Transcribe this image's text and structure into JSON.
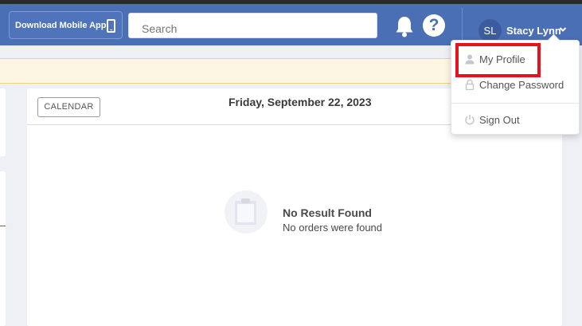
{
  "header": {
    "download_label": "Download Mobile App",
    "search_placeholder": "Search",
    "user": {
      "initials": "SL",
      "name": "Stacy Lynn"
    }
  },
  "main": {
    "calendar_label": "CALENDAR",
    "date": "Friday, September 22, 2023",
    "empty_title": "No Result Found",
    "empty_subtitle": "No orders were found"
  },
  "user_menu": {
    "items": [
      {
        "label": "My Profile",
        "icon": "user-icon"
      },
      {
        "label": "Change Password",
        "icon": "lock-icon"
      },
      {
        "label": "Sign Out",
        "icon": "power-icon"
      }
    ],
    "highlighted_item": "My Profile"
  },
  "colors": {
    "header_bg": "#4a6fb5",
    "highlight": "#e4141e",
    "banner": "#fdf6e3"
  }
}
